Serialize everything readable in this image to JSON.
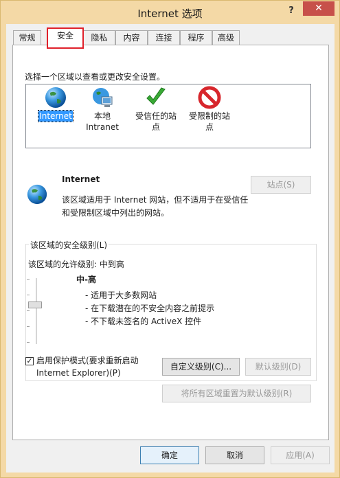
{
  "window": {
    "title": "Internet 选项",
    "help_label": "?",
    "close_label": "✕"
  },
  "tabs": [
    {
      "label": "常规"
    },
    {
      "label": "安全"
    },
    {
      "label": "隐私"
    },
    {
      "label": "内容"
    },
    {
      "label": "连接"
    },
    {
      "label": "程序"
    },
    {
      "label": "高级"
    }
  ],
  "security": {
    "instruction": "选择一个区域以查看或更改安全设置。",
    "zones": [
      {
        "label": "Internet",
        "icon": "globe-icon"
      },
      {
        "label": "本地\nIntranet",
        "icon": "intranet-icon"
      },
      {
        "label": "受信任的站\n点",
        "icon": "checkmark-icon"
      },
      {
        "label": "受限制的站\n点",
        "icon": "restricted-icon"
      }
    ],
    "selected_zone": "Internet",
    "zone_name": "Internet",
    "zone_description": "该区域适用于 Internet 网站，但不适用于在受信任\n和受限制区域中列出的网站。",
    "sites_button": "站点(S)",
    "level_group_label": "该区域的安全级别(L)",
    "allowed_levels": "该区域的允许级别: 中到高",
    "level_name": "中-高",
    "level_bullets": [
      "- 适用于大多数网站",
      "- 在下载潜在的不安全内容之前提示",
      "- 不下载未签名的 ActiveX 控件"
    ],
    "protected_mode_label": "启用保护模式(要求重新启动\nInternet Explorer)(P)",
    "protected_mode_checked": true,
    "custom_level_button": "自定义级别(C)...",
    "default_level_button": "默认级别(D)",
    "reset_all_button": "将所有区域重置为默认级别(R)"
  },
  "footer": {
    "ok_button": "确定",
    "cancel_button": "取消",
    "apply_button": "应用(A)"
  },
  "colors": {
    "window_frame": "#f4d9a6",
    "close_button": "#c7504a",
    "highlight_box": "#e0202a",
    "selection": "#3399ff"
  }
}
